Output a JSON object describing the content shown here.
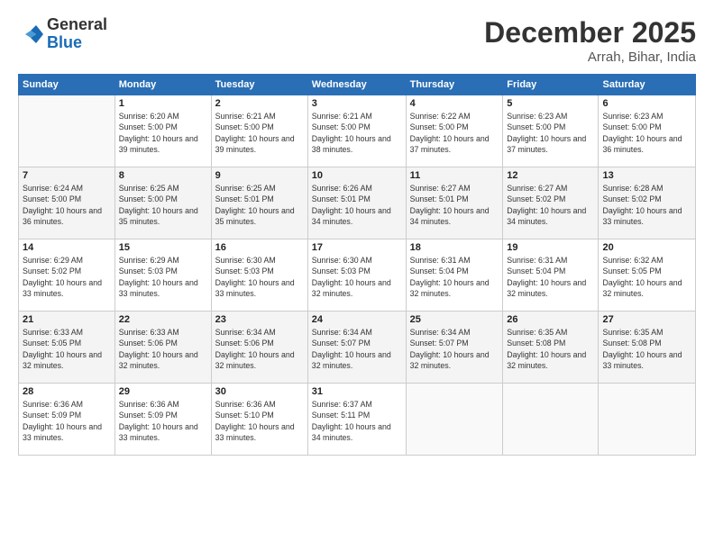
{
  "logo": {
    "general": "General",
    "blue": "Blue"
  },
  "header": {
    "title": "December 2025",
    "location": "Arrah, Bihar, India"
  },
  "weekdays": [
    "Sunday",
    "Monday",
    "Tuesday",
    "Wednesday",
    "Thursday",
    "Friday",
    "Saturday"
  ],
  "weeks": [
    [
      {
        "day": "",
        "sunrise": "",
        "sunset": "",
        "daylight": ""
      },
      {
        "day": "1",
        "sunrise": "Sunrise: 6:20 AM",
        "sunset": "Sunset: 5:00 PM",
        "daylight": "Daylight: 10 hours and 39 minutes."
      },
      {
        "day": "2",
        "sunrise": "Sunrise: 6:21 AM",
        "sunset": "Sunset: 5:00 PM",
        "daylight": "Daylight: 10 hours and 39 minutes."
      },
      {
        "day": "3",
        "sunrise": "Sunrise: 6:21 AM",
        "sunset": "Sunset: 5:00 PM",
        "daylight": "Daylight: 10 hours and 38 minutes."
      },
      {
        "day": "4",
        "sunrise": "Sunrise: 6:22 AM",
        "sunset": "Sunset: 5:00 PM",
        "daylight": "Daylight: 10 hours and 37 minutes."
      },
      {
        "day": "5",
        "sunrise": "Sunrise: 6:23 AM",
        "sunset": "Sunset: 5:00 PM",
        "daylight": "Daylight: 10 hours and 37 minutes."
      },
      {
        "day": "6",
        "sunrise": "Sunrise: 6:23 AM",
        "sunset": "Sunset: 5:00 PM",
        "daylight": "Daylight: 10 hours and 36 minutes."
      }
    ],
    [
      {
        "day": "7",
        "sunrise": "Sunrise: 6:24 AM",
        "sunset": "Sunset: 5:00 PM",
        "daylight": "Daylight: 10 hours and 36 minutes."
      },
      {
        "day": "8",
        "sunrise": "Sunrise: 6:25 AM",
        "sunset": "Sunset: 5:00 PM",
        "daylight": "Daylight: 10 hours and 35 minutes."
      },
      {
        "day": "9",
        "sunrise": "Sunrise: 6:25 AM",
        "sunset": "Sunset: 5:01 PM",
        "daylight": "Daylight: 10 hours and 35 minutes."
      },
      {
        "day": "10",
        "sunrise": "Sunrise: 6:26 AM",
        "sunset": "Sunset: 5:01 PM",
        "daylight": "Daylight: 10 hours and 34 minutes."
      },
      {
        "day": "11",
        "sunrise": "Sunrise: 6:27 AM",
        "sunset": "Sunset: 5:01 PM",
        "daylight": "Daylight: 10 hours and 34 minutes."
      },
      {
        "day": "12",
        "sunrise": "Sunrise: 6:27 AM",
        "sunset": "Sunset: 5:02 PM",
        "daylight": "Daylight: 10 hours and 34 minutes."
      },
      {
        "day": "13",
        "sunrise": "Sunrise: 6:28 AM",
        "sunset": "Sunset: 5:02 PM",
        "daylight": "Daylight: 10 hours and 33 minutes."
      }
    ],
    [
      {
        "day": "14",
        "sunrise": "Sunrise: 6:29 AM",
        "sunset": "Sunset: 5:02 PM",
        "daylight": "Daylight: 10 hours and 33 minutes."
      },
      {
        "day": "15",
        "sunrise": "Sunrise: 6:29 AM",
        "sunset": "Sunset: 5:03 PM",
        "daylight": "Daylight: 10 hours and 33 minutes."
      },
      {
        "day": "16",
        "sunrise": "Sunrise: 6:30 AM",
        "sunset": "Sunset: 5:03 PM",
        "daylight": "Daylight: 10 hours and 33 minutes."
      },
      {
        "day": "17",
        "sunrise": "Sunrise: 6:30 AM",
        "sunset": "Sunset: 5:03 PM",
        "daylight": "Daylight: 10 hours and 32 minutes."
      },
      {
        "day": "18",
        "sunrise": "Sunrise: 6:31 AM",
        "sunset": "Sunset: 5:04 PM",
        "daylight": "Daylight: 10 hours and 32 minutes."
      },
      {
        "day": "19",
        "sunrise": "Sunrise: 6:31 AM",
        "sunset": "Sunset: 5:04 PM",
        "daylight": "Daylight: 10 hours and 32 minutes."
      },
      {
        "day": "20",
        "sunrise": "Sunrise: 6:32 AM",
        "sunset": "Sunset: 5:05 PM",
        "daylight": "Daylight: 10 hours and 32 minutes."
      }
    ],
    [
      {
        "day": "21",
        "sunrise": "Sunrise: 6:33 AM",
        "sunset": "Sunset: 5:05 PM",
        "daylight": "Daylight: 10 hours and 32 minutes."
      },
      {
        "day": "22",
        "sunrise": "Sunrise: 6:33 AM",
        "sunset": "Sunset: 5:06 PM",
        "daylight": "Daylight: 10 hours and 32 minutes."
      },
      {
        "day": "23",
        "sunrise": "Sunrise: 6:34 AM",
        "sunset": "Sunset: 5:06 PM",
        "daylight": "Daylight: 10 hours and 32 minutes."
      },
      {
        "day": "24",
        "sunrise": "Sunrise: 6:34 AM",
        "sunset": "Sunset: 5:07 PM",
        "daylight": "Daylight: 10 hours and 32 minutes."
      },
      {
        "day": "25",
        "sunrise": "Sunrise: 6:34 AM",
        "sunset": "Sunset: 5:07 PM",
        "daylight": "Daylight: 10 hours and 32 minutes."
      },
      {
        "day": "26",
        "sunrise": "Sunrise: 6:35 AM",
        "sunset": "Sunset: 5:08 PM",
        "daylight": "Daylight: 10 hours and 32 minutes."
      },
      {
        "day": "27",
        "sunrise": "Sunrise: 6:35 AM",
        "sunset": "Sunset: 5:08 PM",
        "daylight": "Daylight: 10 hours and 33 minutes."
      }
    ],
    [
      {
        "day": "28",
        "sunrise": "Sunrise: 6:36 AM",
        "sunset": "Sunset: 5:09 PM",
        "daylight": "Daylight: 10 hours and 33 minutes."
      },
      {
        "day": "29",
        "sunrise": "Sunrise: 6:36 AM",
        "sunset": "Sunset: 5:09 PM",
        "daylight": "Daylight: 10 hours and 33 minutes."
      },
      {
        "day": "30",
        "sunrise": "Sunrise: 6:36 AM",
        "sunset": "Sunset: 5:10 PM",
        "daylight": "Daylight: 10 hours and 33 minutes."
      },
      {
        "day": "31",
        "sunrise": "Sunrise: 6:37 AM",
        "sunset": "Sunset: 5:11 PM",
        "daylight": "Daylight: 10 hours and 34 minutes."
      },
      {
        "day": "",
        "sunrise": "",
        "sunset": "",
        "daylight": ""
      },
      {
        "day": "",
        "sunrise": "",
        "sunset": "",
        "daylight": ""
      },
      {
        "day": "",
        "sunrise": "",
        "sunset": "",
        "daylight": ""
      }
    ]
  ]
}
